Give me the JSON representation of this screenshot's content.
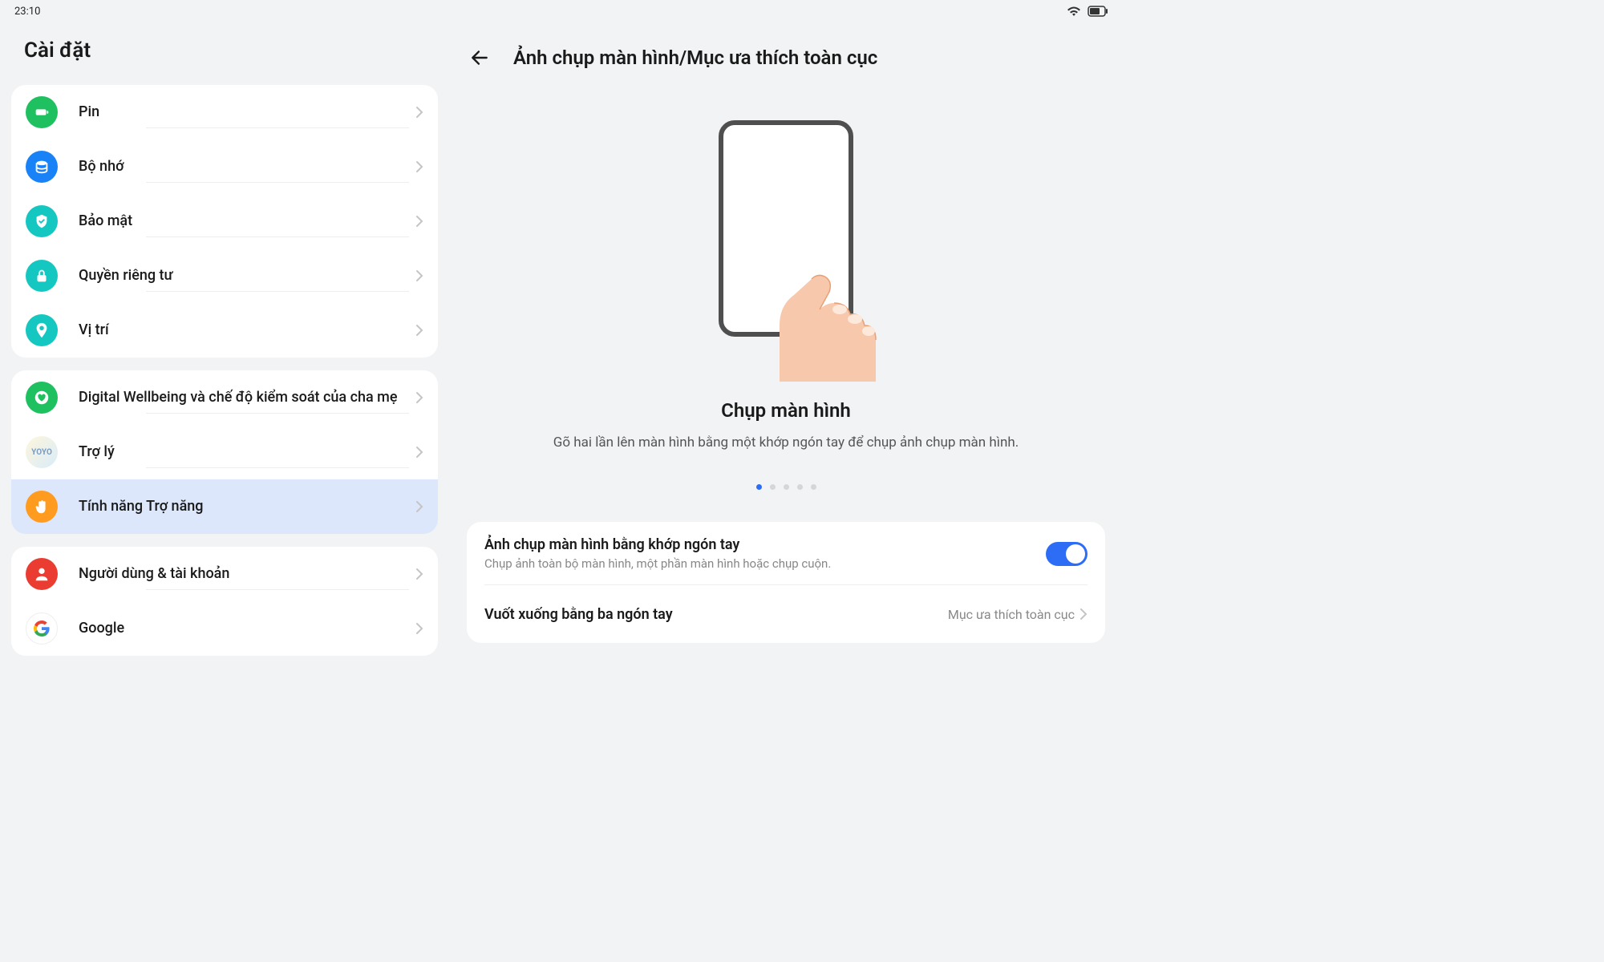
{
  "status": {
    "time": "23:10"
  },
  "sidebar": {
    "title": "Cài đặt",
    "groups": [
      {
        "items": [
          {
            "id": "pin",
            "label": "Pin",
            "iconClass": "icon-pin",
            "svg": "battery"
          },
          {
            "id": "storage",
            "label": "Bộ nhớ",
            "iconClass": "icon-storage",
            "svg": "storage"
          },
          {
            "id": "security",
            "label": "Bảo mật",
            "iconClass": "icon-security",
            "svg": "shield"
          },
          {
            "id": "privacy",
            "label": "Quyền riêng tư",
            "iconClass": "icon-privacy",
            "svg": "lock"
          },
          {
            "id": "location",
            "label": "Vị trí",
            "iconClass": "icon-location",
            "svg": "pin"
          }
        ]
      },
      {
        "items": [
          {
            "id": "wellbeing",
            "label": "Digital Wellbeing và chế độ kiểm soát của cha mẹ",
            "iconClass": "icon-wellbeing",
            "svg": "heart"
          },
          {
            "id": "assistant",
            "label": "Trợ lý",
            "iconClass": "icon-yoyo",
            "svg": "yoyo"
          },
          {
            "id": "accessibility",
            "label": "Tính năng Trợ năng",
            "iconClass": "icon-accessibility",
            "svg": "hand",
            "selected": true
          }
        ]
      },
      {
        "items": [
          {
            "id": "users",
            "label": "Người dùng & tài khoản",
            "iconClass": "icon-users",
            "svg": "user"
          },
          {
            "id": "google",
            "label": "Google",
            "iconClass": "icon-google",
            "svg": "google"
          }
        ]
      }
    ]
  },
  "detail": {
    "title": "Ảnh chụp màn hình/Mục ưa thích toàn cục",
    "illustration": {
      "title": "Chụp màn hình",
      "desc": "Gõ hai lần lên màn hình bằng một khớp ngón tay để chụp ảnh chụp màn hình."
    },
    "dots": {
      "count": 5,
      "active": 0
    },
    "settings": [
      {
        "title": "Ảnh chụp màn hình bằng khớp ngón tay",
        "sub": "Chụp ảnh toàn bộ màn hình, một phần màn hình hoặc chụp cuộn.",
        "type": "toggle",
        "value": true
      },
      {
        "title": "Vuốt xuống bằng ba ngón tay",
        "type": "link",
        "right": "Mục ưa thích toàn cục"
      }
    ]
  }
}
